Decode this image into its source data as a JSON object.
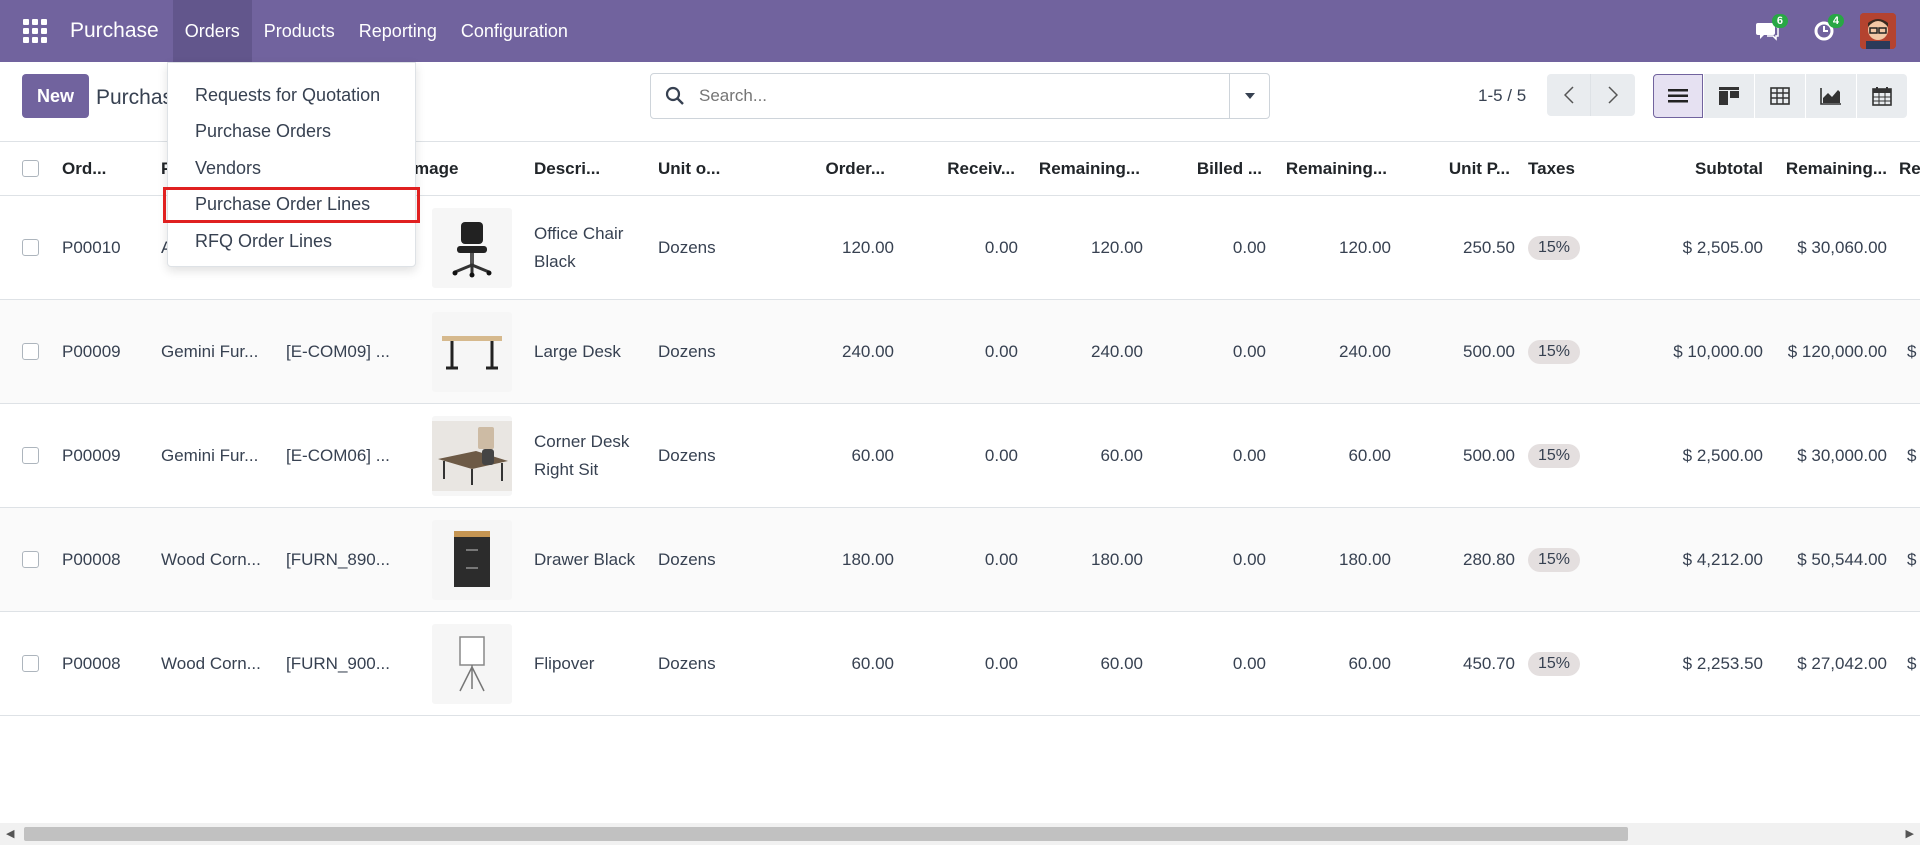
{
  "navbar": {
    "app_name": "Purchase",
    "menu": [
      "Orders",
      "Products",
      "Reporting",
      "Configuration"
    ],
    "messages_count": "6",
    "activities_count": "4"
  },
  "orders_menu": {
    "items": [
      "Requests for Quotation",
      "Purchase Orders",
      "Vendors",
      "Purchase Order Lines",
      "RFQ Order Lines"
    ],
    "highlighted_index": 3
  },
  "control": {
    "new_label": "New",
    "breadcrumb": "Purchas",
    "search_placeholder": "Search...",
    "pager": "1-5 / 5"
  },
  "table": {
    "columns": [
      "Ord...",
      "P",
      "",
      "mage",
      "Descri...",
      "Unit o...",
      "Order...",
      "Receiv...",
      "Remaining...",
      "Billed ...",
      "Remaining...",
      "Unit P...",
      "Taxes",
      "Subtotal",
      "Remaining...",
      "Re"
    ],
    "rows": [
      {
        "order": "P00010",
        "partner": "A",
        "product": "",
        "desc": "Office Chair Black",
        "uom": "Dozens",
        "ordered": "120.00",
        "received": "0.00",
        "remaining1": "120.00",
        "billed": "0.00",
        "remaining2": "120.00",
        "unit_price": "250.50",
        "tax": "15%",
        "subtotal": "$ 2,505.00",
        "remaining3": "$ 30,060.00",
        "extra": "",
        "thumb": "chair"
      },
      {
        "order": "P00009",
        "partner": "Gemini Fur...",
        "product": "[E-COM09] ...",
        "desc": "Large Desk",
        "uom": "Dozens",
        "ordered": "240.00",
        "received": "0.00",
        "remaining1": "240.00",
        "billed": "0.00",
        "remaining2": "240.00",
        "unit_price": "500.00",
        "tax": "15%",
        "subtotal": "$ 10,000.00",
        "remaining3": "$ 120,000.00",
        "extra": "$",
        "thumb": "desk"
      },
      {
        "order": "P00009",
        "partner": "Gemini Fur...",
        "product": "[E-COM06] ...",
        "desc": "Corner Desk Right Sit",
        "uom": "Dozens",
        "ordered": "60.00",
        "received": "0.00",
        "remaining1": "60.00",
        "billed": "0.00",
        "remaining2": "60.00",
        "unit_price": "500.00",
        "tax": "15%",
        "subtotal": "$ 2,500.00",
        "remaining3": "$ 30,000.00",
        "extra": "$",
        "thumb": "corner"
      },
      {
        "order": "P00008",
        "partner": "Wood Corn...",
        "product": "[FURN_890...",
        "desc": "Drawer Black",
        "uom": "Dozens",
        "ordered": "180.00",
        "received": "0.00",
        "remaining1": "180.00",
        "billed": "0.00",
        "remaining2": "180.00",
        "unit_price": "280.80",
        "tax": "15%",
        "subtotal": "$ 4,212.00",
        "remaining3": "$ 50,544.00",
        "extra": "$",
        "thumb": "drawer"
      },
      {
        "order": "P00008",
        "partner": "Wood Corn...",
        "product": "[FURN_900...",
        "desc": "Flipover",
        "uom": "Dozens",
        "ordered": "60.00",
        "received": "0.00",
        "remaining1": "60.00",
        "billed": "0.00",
        "remaining2": "60.00",
        "unit_price": "450.70",
        "tax": "15%",
        "subtotal": "$ 2,253.50",
        "remaining3": "$ 27,042.00",
        "extra": "$",
        "thumb": "flip"
      }
    ]
  },
  "colors": {
    "brand": "#71639e",
    "highlight": "#e02020"
  }
}
